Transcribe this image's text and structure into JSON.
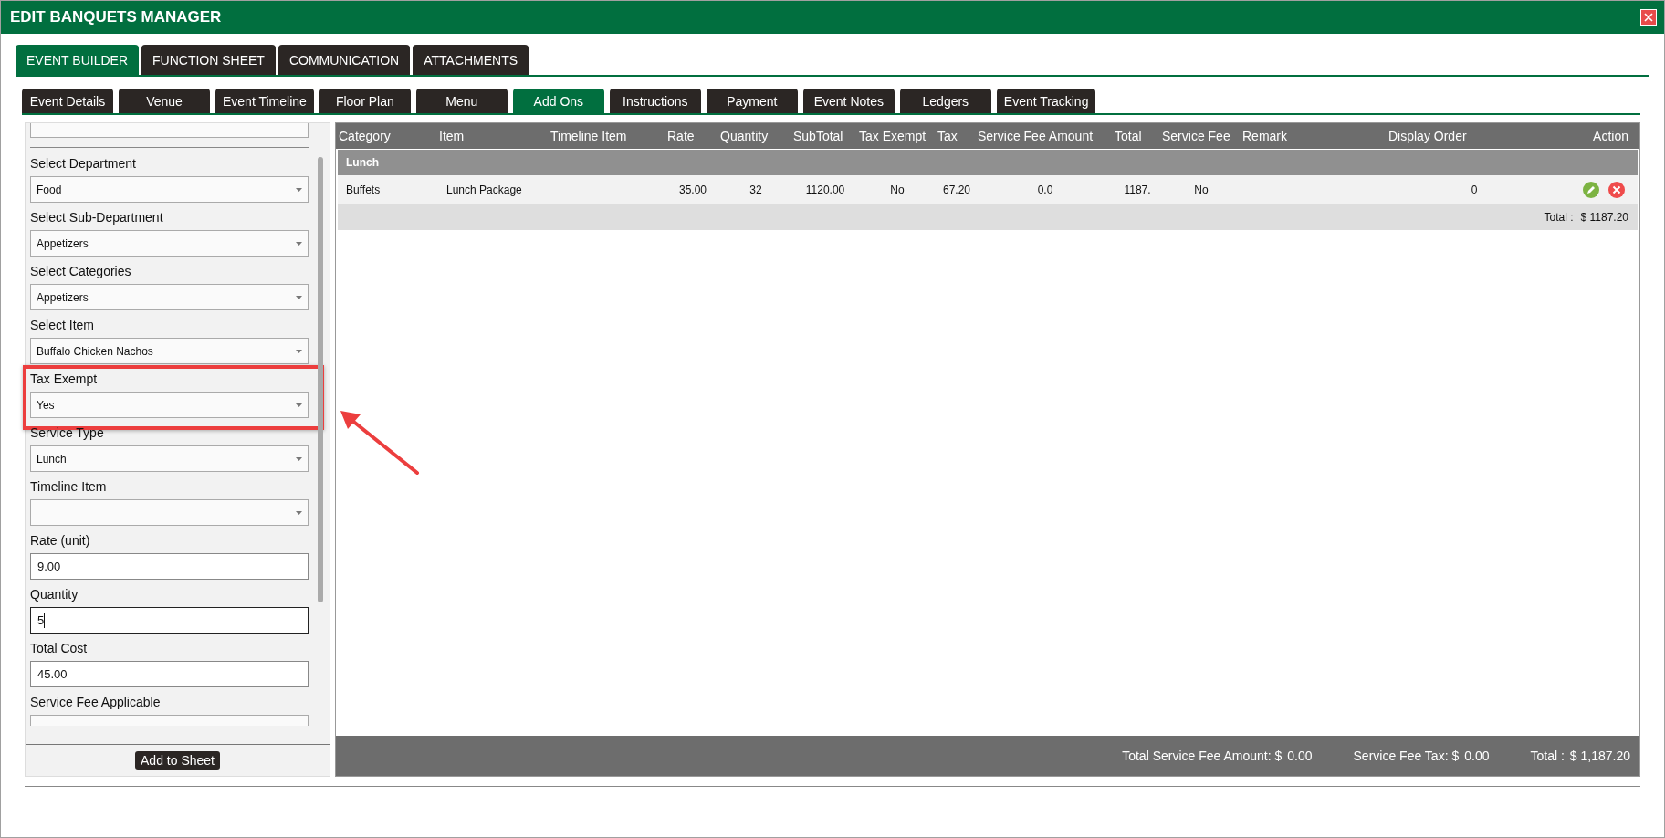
{
  "window": {
    "title": "EDIT BANQUETS MANAGER"
  },
  "main_tabs": [
    {
      "label": "EVENT BUILDER",
      "selected": true
    },
    {
      "label": "FUNCTION SHEET",
      "selected": false
    },
    {
      "label": "COMMUNICATION",
      "selected": false
    },
    {
      "label": "ATTACHMENTS",
      "selected": false
    }
  ],
  "sub_tabs": [
    {
      "label": "Event Details",
      "selected": false
    },
    {
      "label": "Venue",
      "selected": false
    },
    {
      "label": "Event Timeline",
      "selected": false
    },
    {
      "label": "Floor Plan",
      "selected": false
    },
    {
      "label": "Menu",
      "selected": false
    },
    {
      "label": "Add Ons",
      "selected": true
    },
    {
      "label": "Instructions",
      "selected": false
    },
    {
      "label": "Payment",
      "selected": false
    },
    {
      "label": "Event Notes",
      "selected": false
    },
    {
      "label": "Ledgers",
      "selected": false
    },
    {
      "label": "Event Tracking",
      "selected": false
    }
  ],
  "form": {
    "fields": [
      {
        "label": "Select Department",
        "kind": "select",
        "value": "Food",
        "focused": false,
        "highlighted": false
      },
      {
        "label": "Select Sub-Department",
        "kind": "select",
        "value": "Appetizers",
        "focused": false,
        "highlighted": false
      },
      {
        "label": "Select Categories",
        "kind": "select",
        "value": "Appetizers",
        "focused": false,
        "highlighted": false
      },
      {
        "label": "Select Item",
        "kind": "select",
        "value": "Buffalo Chicken Nachos",
        "focused": false,
        "highlighted": false
      },
      {
        "label": "Tax Exempt",
        "kind": "select",
        "value": "Yes",
        "focused": false,
        "highlighted": true
      },
      {
        "label": "Service Type",
        "kind": "select",
        "value": "Lunch",
        "focused": false,
        "highlighted": false
      },
      {
        "label": "Timeline Item",
        "kind": "select",
        "focused": false,
        "highlighted": false
      },
      {
        "label": "Rate (unit)",
        "kind": "input",
        "value": "9.00",
        "focused": false,
        "highlighted": false
      },
      {
        "label": "Quantity",
        "kind": "input",
        "value": "5",
        "focused": true,
        "highlighted": false
      },
      {
        "label": "Total Cost",
        "kind": "input",
        "value": "45.00",
        "focused": false,
        "highlighted": false
      },
      {
        "label": "Service Fee Applicable",
        "kind": "partial",
        "focused": false,
        "highlighted": false
      }
    ],
    "button": "Add to Sheet"
  },
  "table": {
    "columns": [
      "Category",
      "Item",
      "Timeline Item",
      "Rate",
      "Quantity",
      "SubTotal",
      "Tax Exempt",
      "Tax",
      "Service Fee Amount",
      "Total",
      "Service Fee",
      "Remark",
      "Display Order",
      "Action"
    ],
    "groups": [
      {
        "name": "Lunch",
        "rows": [
          {
            "category": "Buffets",
            "item": "Lunch Package",
            "rate": "35.00",
            "quantity": "32",
            "subtotal": "1120.00",
            "tax_exempt": "No",
            "tax": "67.20",
            "service_fee_amount": "0.0",
            "total": "1187.",
            "service_fee": "No",
            "display_order": "0"
          }
        ],
        "total_label": "Total :",
        "total_value": "$ 1187.20"
      }
    ]
  },
  "footer": [
    {
      "label": "Total Service Fee Amount: $",
      "value": "0.00"
    },
    {
      "label": "Service Fee Tax: $",
      "value": "0.00"
    },
    {
      "label": "Total :",
      "value": "$ 1,187.20"
    }
  ]
}
